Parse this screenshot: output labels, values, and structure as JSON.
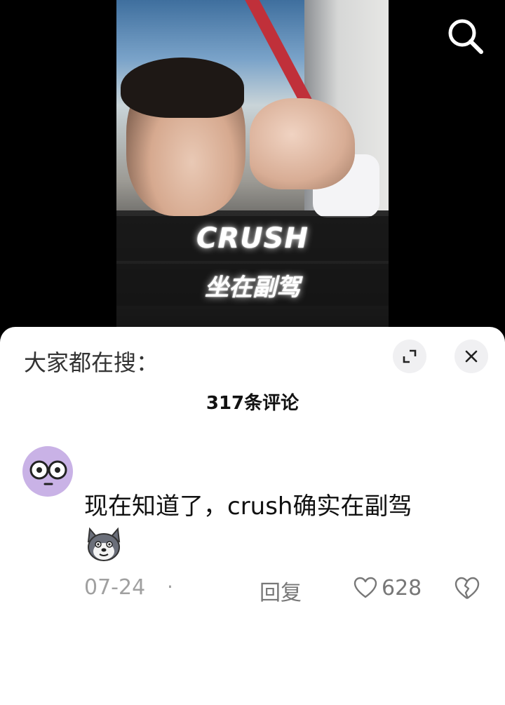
{
  "video": {
    "caption_top": "CRUSH",
    "caption_bottom": "坐在副驾"
  },
  "icons": {
    "search": "search-icon",
    "expand": "expand-icon",
    "close": "close-icon",
    "like": "heart-icon",
    "dislike": "broken-heart-icon"
  },
  "panel": {
    "hot_search_label": "大家都在搜：",
    "comment_count": "317条评论"
  },
  "comment": {
    "text": "现在知道了，crush确实在副驾",
    "date": "07-24",
    "separator": "·",
    "reply_label": "回复",
    "like_count": "628"
  },
  "colors": {
    "avatar_bg": "#c9b2e6",
    "muted_text": "#a0a0a0"
  }
}
